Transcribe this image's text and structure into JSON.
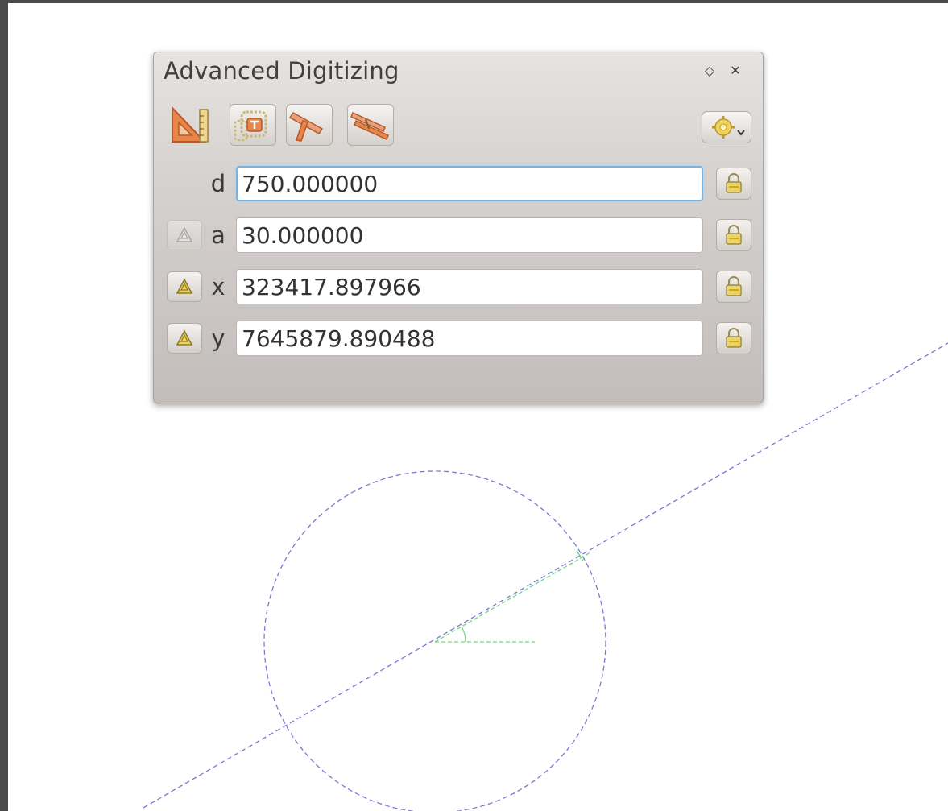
{
  "panel": {
    "title": "Advanced Digitizing",
    "float_icon": "float-diamond-icon",
    "close_icon": "close-icon"
  },
  "toolbar": {
    "tools": [
      {
        "name": "enable-advanced-digitizing",
        "icon": "set-square-ruler-icon",
        "active": true
      },
      {
        "name": "construction-mode",
        "icon": "construction-frame-icon",
        "active": true
      },
      {
        "name": "perpendicular",
        "icon": "perpendicular-ruler-icon",
        "active": false
      },
      {
        "name": "parallel",
        "icon": "parallel-ruler-icon",
        "active": false
      }
    ],
    "settings_icon": "gear-dropdown-icon"
  },
  "fields": {
    "d": {
      "label": "d",
      "value": "750.000000"
    },
    "a": {
      "label": "a",
      "value": "30.000000"
    },
    "x": {
      "label": "x",
      "value": "323417.897966"
    },
    "y": {
      "label": "y",
      "value": "7645879.890488"
    }
  },
  "colors": {
    "construction_line": "#7b78d6",
    "guide_line": "#6fd67a",
    "accent_orange": "#e8864a",
    "lock_yellow": "#f0d35a"
  }
}
